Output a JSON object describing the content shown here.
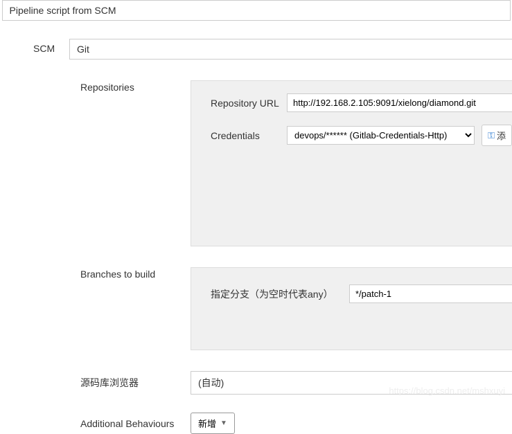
{
  "top": {
    "definition": "Pipeline script from SCM"
  },
  "scm": {
    "label": "SCM",
    "value": "Git"
  },
  "repositories": {
    "label": "Repositories",
    "url_label": "Repository URL",
    "url_value": "http://192.168.2.105:9091/xielong/diamond.git",
    "cred_label": "Credentials",
    "cred_value": "devops/****** (Gitlab-Credentials-Http)",
    "add_label": "添"
  },
  "branches": {
    "label": "Branches to build",
    "spec_label": "指定分支（为空时代表any）",
    "spec_value": "*/patch-1"
  },
  "browser": {
    "label": "源码库浏览器",
    "value": "(自动)"
  },
  "behaviours": {
    "label": "Additional Behaviours",
    "add_label": "新增"
  },
  "watermark": "https://blog.csdn.net/mshxuyi"
}
